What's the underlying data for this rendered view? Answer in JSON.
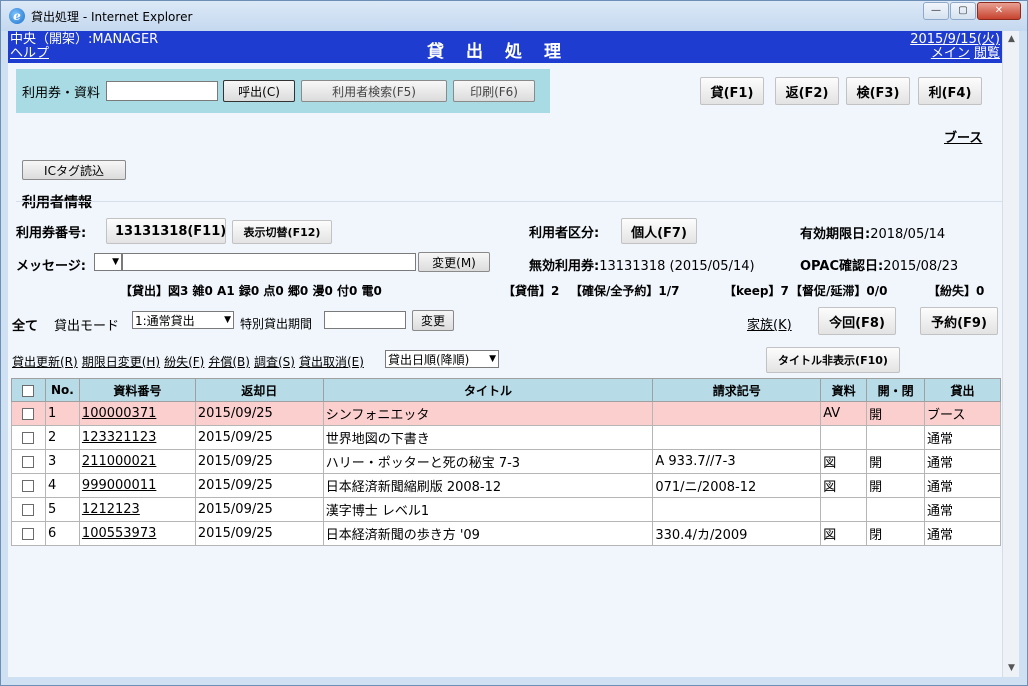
{
  "window": {
    "title": "貸出処理 - Internet Explorer",
    "min_label": "—",
    "max_label": "▢",
    "close_label": "✕"
  },
  "header": {
    "user": "中央（開架）:MANAGER",
    "help": "ヘルプ",
    "title": "貸出処理",
    "date": "2015/9/15(火)",
    "menu": "メイン",
    "browse": "閲覧"
  },
  "search": {
    "label": "利用券・資料",
    "input_value": "",
    "call_btn": "呼出(C)",
    "user_search_btn": "利用者検索(F5)",
    "print_btn": "印刷(F6)"
  },
  "func_buttons": [
    "貸(F1)",
    "返(F2)",
    "検(F3)",
    "利(F4)"
  ],
  "booth_link": "ブース",
  "ic_tag_btn": "ICタグ読込",
  "user_info": {
    "section_title": "利用者情報",
    "card_label": "利用券番号:",
    "card_number": "13131318(F11)",
    "toggle_btn": "表示切替(F12)",
    "category_label": "利用者区分:",
    "category_value": "個人(F7)",
    "expiry_label": "有効期限日:",
    "expiry_value": "2018/05/14",
    "message_label": "メッセージ:",
    "message_select": "",
    "message_value": "",
    "change_btn_m": "変更(M)",
    "invalid_label": "無効利用券:",
    "invalid_value": "13131318 (2015/05/14)",
    "opac_label": "OPAC確認日:",
    "opac_value": "2015/08/23",
    "loan_counts": "【貸出】図3 雑0 A1 録0 点0 郷0 漫0 付0 電0",
    "borrow": "【貸借】2",
    "reserve": "【確保/全予約】1/7",
    "keep": "【keep】7",
    "overdue": "【督促/延滞】0/0",
    "lost": "【紛失】0"
  },
  "mode": {
    "all": "全て",
    "mode_label": "貸出モード",
    "mode_value": "1:通常貸出",
    "special_label": "特別貸出期間",
    "special_value": "",
    "change_btn": "変更",
    "family_link": "家族(K)",
    "this_time_btn": "今回(F8)",
    "reserve_btn": "予約(F9)"
  },
  "actions": {
    "links": [
      "貸出更新(R)",
      "期限日変更(H)",
      "紛失(F)",
      "弁償(B)",
      "調査(S)",
      "貸出取消(E)"
    ],
    "sort_value": "貸出日順(降順)",
    "hide_title_btn": "タイトル非表示(F10)"
  },
  "table": {
    "headers": [
      "No.",
      "資料番号",
      "返却日",
      "タイトル",
      "請求記号",
      "資料",
      "開・閉",
      "貸出"
    ],
    "rows": [
      {
        "no": "1",
        "id": "100000371",
        "due": "2015/09/25",
        "title": "シンフォニエッタ",
        "call": "",
        "type": "AV",
        "open": "開",
        "loan": "ブース"
      },
      {
        "no": "2",
        "id": "123321123",
        "due": "2015/09/25",
        "title": "世界地図の下書き",
        "call": "",
        "type": "",
        "open": "",
        "loan": "通常"
      },
      {
        "no": "3",
        "id": "211000021",
        "due": "2015/09/25",
        "title": "ハリー・ポッターと死の秘宝 7-3",
        "call": "A 933.7//7-3",
        "type": "図",
        "open": "開",
        "loan": "通常"
      },
      {
        "no": "4",
        "id": "999000011",
        "due": "2015/09/25",
        "title": "日本経済新聞縮刷版 2008-12",
        "call": "071/ニ/2008-12",
        "type": "図",
        "open": "開",
        "loan": "通常"
      },
      {
        "no": "5",
        "id": "1212123",
        "due": "2015/09/25",
        "title": "漢字博士 レベル1",
        "call": "",
        "type": "",
        "open": "",
        "loan": "通常"
      },
      {
        "no": "6",
        "id": "100553973",
        "due": "2015/09/25",
        "title": "日本経済新聞の歩き方 '09",
        "call": "330.4/カ/2009",
        "type": "図",
        "open": "閉",
        "loan": "通常"
      }
    ]
  },
  "colors": {
    "header_bg": "#1f3cd1",
    "search_bg": "#a9dbe4",
    "table_header_bg": "#b7dbe7",
    "highlight_row": "#fccfcf"
  }
}
